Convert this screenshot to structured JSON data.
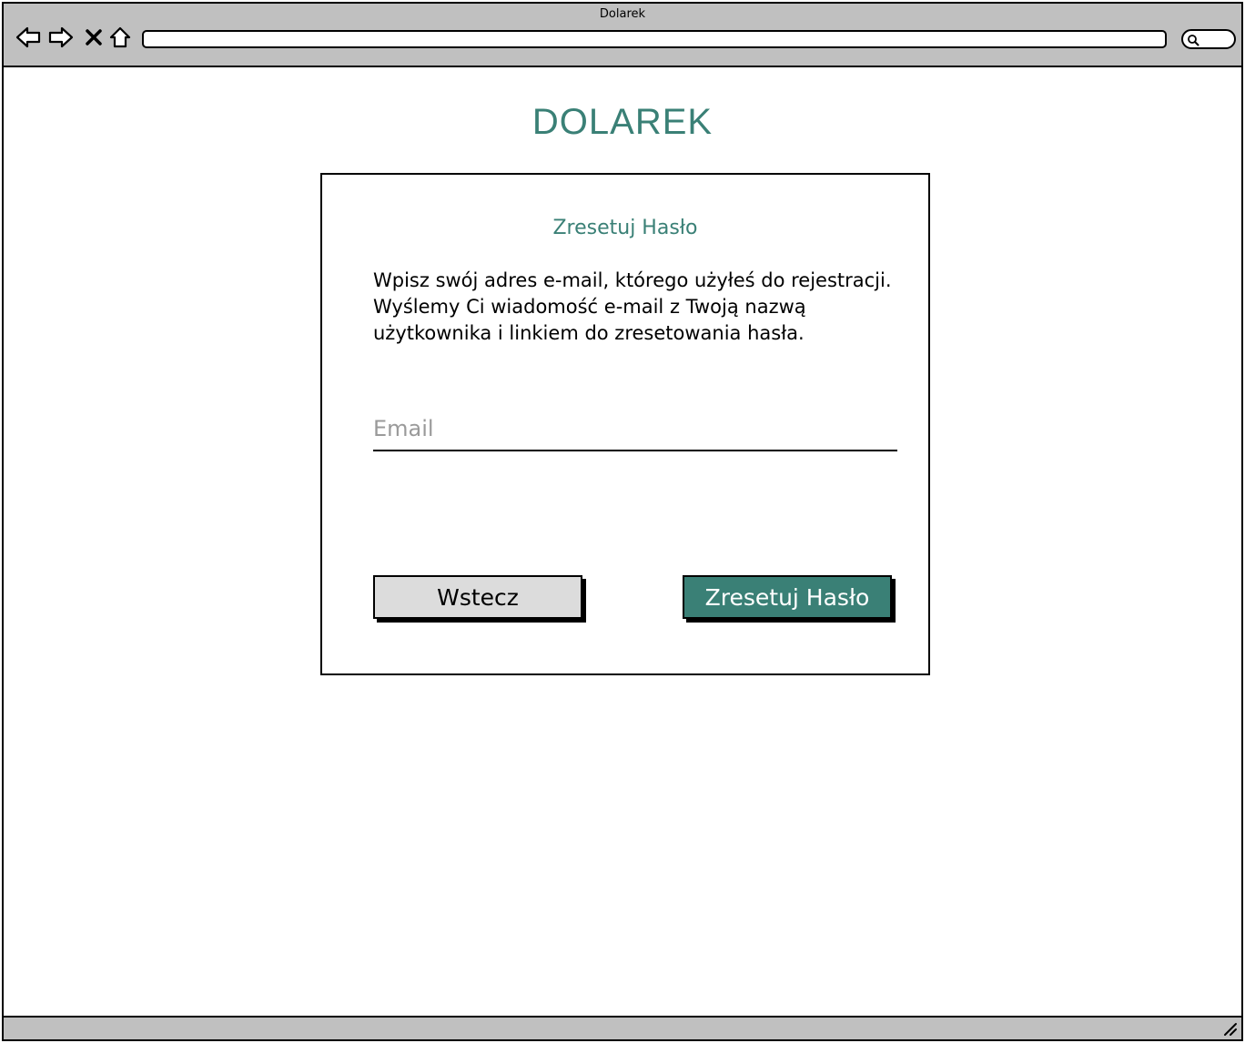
{
  "window": {
    "title": "Dolarek"
  },
  "toolbar": {
    "back_icon": "arrow-left-icon",
    "forward_icon": "arrow-right-icon",
    "close_icon": "close-icon",
    "home_icon": "home-icon",
    "address": ""
  },
  "page": {
    "brand": "DOLAREK",
    "card_title": "Zresetuj Hasło",
    "description": "Wpisz swój adres e-mail, którego użyłeś do rejestracji. Wyślemy Ci wiadomość e-mail z Twoją nazwą użytkownika i linkiem do zresetowania hasła.",
    "email_placeholder": "Email",
    "email_value": "",
    "back_label": "Wstecz",
    "reset_label": "Zresetuj Hasło"
  },
  "colors": {
    "accent": "#3a8076",
    "chrome": "#c0c0c0",
    "secondary_button": "#dcdcdc"
  }
}
